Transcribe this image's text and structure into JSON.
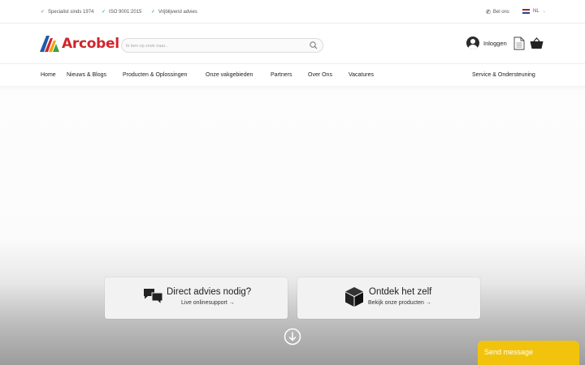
{
  "topbar": {
    "usps": [
      "Specialist sinds 1974",
      "ISO 9001:2015",
      "Vrijblijvend advies"
    ],
    "call_label": "Bel ons",
    "language": "NL"
  },
  "header": {
    "brand": "Arcobel",
    "search_placeholder": "Ik ben op zoek naar...",
    "login_label": "Inloggen"
  },
  "nav": {
    "items": [
      "Home",
      "Nieuws & Blogs",
      "Producten & Oplossingen",
      "Onze vakgebieden",
      "Partners",
      "Over Ons",
      "Vacatures"
    ],
    "right_item": "Service & Ondersteuning"
  },
  "hero": {
    "cards": [
      {
        "title": "Direct advies nodig?",
        "subtitle": "Live onlinesupport →",
        "icon": "chat-bubbles-icon"
      },
      {
        "title": "Ontdek het zelf",
        "subtitle": "Bekijk onze producten →",
        "icon": "box-icon"
      }
    ]
  },
  "chat": {
    "label": "Send message"
  },
  "colors": {
    "brand_red": "#d0262d",
    "brand_blue": "#1e5aa8",
    "check_green": "#2a9d4a",
    "chat_yellow": "#f2c30c"
  }
}
